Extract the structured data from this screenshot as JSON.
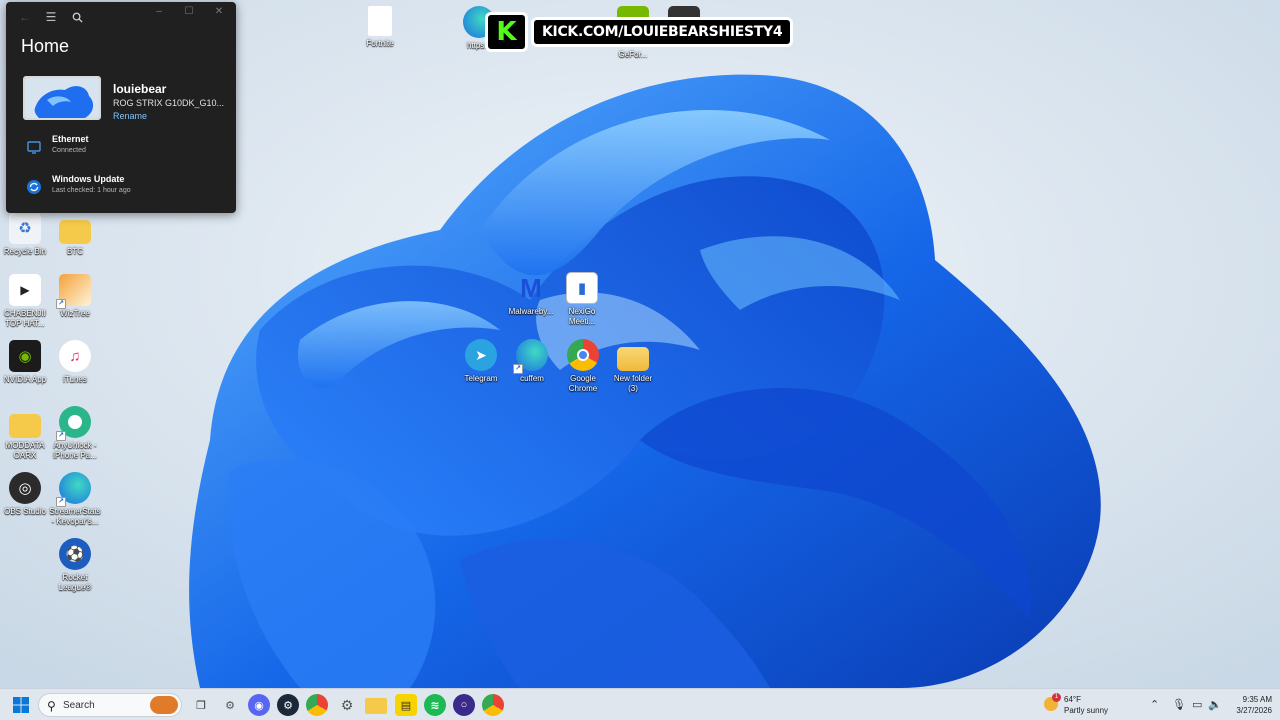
{
  "home_panel": {
    "title": "Home",
    "device": {
      "name": "louiebear",
      "model": "ROG STRIX G10DK_G10...",
      "rename": "Rename"
    },
    "rows": [
      {
        "title": "Ethernet",
        "subtitle": "Connected",
        "icon": "monitor-network-icon"
      },
      {
        "title": "Windows Update",
        "subtitle": "Last checked: 1 hour ago",
        "icon": "sync-icon"
      }
    ]
  },
  "kick": {
    "text": "KICK.COM/LOUIEBEARSHIESTY4",
    "logo": "K"
  },
  "desktop_icons": [
    {
      "name": "fortnite",
      "label": "Fortnite"
    },
    {
      "name": "https",
      "label": "https..."
    },
    {
      "name": "geforce",
      "label": "GeFor..."
    },
    {
      "name": "recycle-bin",
      "label": "Recycle Bin"
    },
    {
      "name": "btc",
      "label": "BTC"
    },
    {
      "name": "chabenjii",
      "label": "CHABENJII\nTOP HAT..."
    },
    {
      "name": "wiztree",
      "label": "WizTree"
    },
    {
      "name": "nvidia-app",
      "label": "NVIDIA App"
    },
    {
      "name": "itunes",
      "label": "iTunes"
    },
    {
      "name": "moddata",
      "label": "MODDATA\nOARX"
    },
    {
      "name": "anyunlock",
      "label": "AnyUnlock -\niPhone Pa..."
    },
    {
      "name": "obs-studio",
      "label": "OBS Studio"
    },
    {
      "name": "streamerstats",
      "label": "StreamerStats\n- Kevopar's..."
    },
    {
      "name": "rocket-league",
      "label": "Rocket\nLeague®"
    },
    {
      "name": "malwarebytes",
      "label": "Malwareby..."
    },
    {
      "name": "nexigo",
      "label": "NexiGo\nMeeti..."
    },
    {
      "name": "telegram",
      "label": "Telegram"
    },
    {
      "name": "cuffem",
      "label": "cuffem"
    },
    {
      "name": "google-chrome",
      "label": "Google\nChrome"
    },
    {
      "name": "new-folder",
      "label": "New folder\n(3)"
    }
  ],
  "taskbar": {
    "search_label": "Search",
    "weather": {
      "temp": "64°F",
      "desc": "Partly sunny",
      "badge": "1"
    },
    "time": "9:35 AM",
    "date": "3/27/2026"
  }
}
